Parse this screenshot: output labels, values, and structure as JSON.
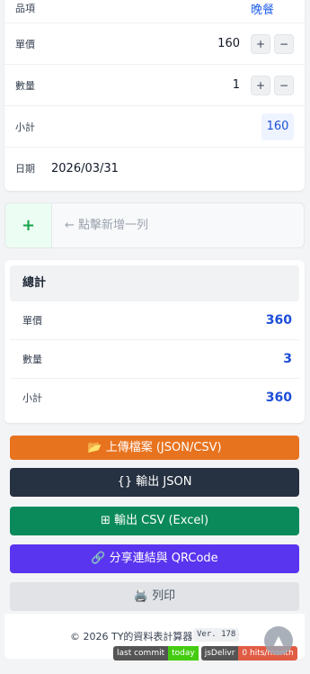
{
  "item": {
    "name_label": "品項",
    "name_value": "晚餐",
    "price_label": "單價",
    "price_value": "160",
    "qty_label": "數量",
    "qty_value": "1",
    "subtotal_label": "小計",
    "subtotal_value": "160",
    "date_label": "日期",
    "date_value": "2026/03/31",
    "plus_symbol": "+",
    "minus_symbol": "−"
  },
  "add_row": {
    "plus_symbol": "+",
    "hint": "← 點擊新增一列"
  },
  "totals": {
    "title": "總計",
    "rows": [
      {
        "label": "單價",
        "value": "360"
      },
      {
        "label": "數量",
        "value": "3"
      },
      {
        "label": "小計",
        "value": "360"
      }
    ]
  },
  "actions": {
    "upload": "📂 上傳檔案 (JSON/CSV)",
    "export_json": "{} 輸出 JSON",
    "export_csv": "⊞ 輸出 CSV (Excel)",
    "share": "🔗 分享連結與 QRCode",
    "print": "🖨️ 列印"
  },
  "footer": {
    "copyright": "© 2026 TY的資料表計算器",
    "version": "Ver. 178",
    "badge_commit_label": "last commit",
    "badge_commit_value": "today",
    "badge_jsdelivr_label": "jsDelivr",
    "badge_jsdelivr_value": "0 hits/month"
  },
  "scroll_top_icon": "▲",
  "colors": {
    "accent_blue": "#1d4ed8",
    "upload_orange": "#e8731f",
    "json_dark": "#263141",
    "csv_green": "#0a8a5a",
    "share_purple": "#5a35f0"
  }
}
